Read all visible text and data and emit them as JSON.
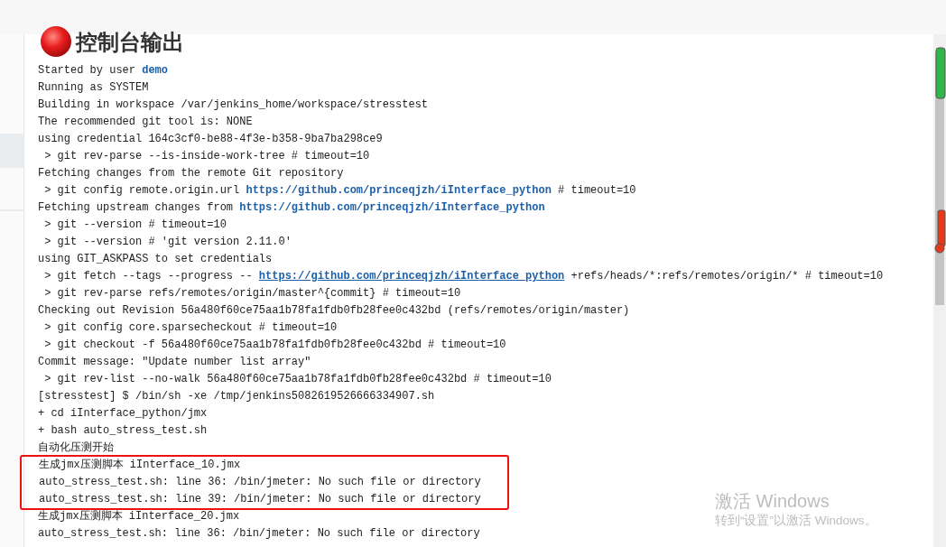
{
  "page_heading": "控制台输出",
  "console": [
    {
      "kind": "plain",
      "lines": [
        [
          {
            "kind": "text",
            "text": "Started by user "
          },
          {
            "kind": "link",
            "text": "demo",
            "underline": false
          }
        ],
        [
          {
            "kind": "text",
            "text": "Running as SYSTEM"
          }
        ],
        [
          {
            "kind": "text",
            "text": "Building in workspace /var/jenkins_home/workspace/stresstest"
          }
        ],
        [
          {
            "kind": "text",
            "text": "The recommended git tool is: NONE"
          }
        ],
        [
          {
            "kind": "text",
            "text": "using credential 164c3cf0-be88-4f3e-b358-9ba7ba298ce9"
          }
        ],
        [
          {
            "kind": "text",
            "text": " > git rev-parse --is-inside-work-tree # timeout=10"
          }
        ],
        [
          {
            "kind": "text",
            "text": "Fetching changes from the remote Git repository"
          }
        ],
        [
          {
            "kind": "text",
            "text": " > git config remote.origin.url "
          },
          {
            "kind": "link",
            "text": "https://github.com/princeqjzh/iInterface_python",
            "underline": false
          },
          {
            "kind": "text",
            "text": " # timeout=10"
          }
        ],
        [
          {
            "kind": "text",
            "text": "Fetching upstream changes from "
          },
          {
            "kind": "link",
            "text": "https://github.com/princeqjzh/iInterface_python",
            "underline": false
          }
        ],
        [
          {
            "kind": "text",
            "text": " > git --version # timeout=10"
          }
        ],
        [
          {
            "kind": "text",
            "text": " > git --version # 'git version 2.11.0'"
          }
        ],
        [
          {
            "kind": "text",
            "text": "using GIT_ASKPASS to set credentials"
          }
        ],
        [
          {
            "kind": "text",
            "text": " > git fetch --tags --progress -- "
          },
          {
            "kind": "link",
            "text": "https://github.com/princeqjzh/iInterface_python",
            "underline": true
          },
          {
            "kind": "text",
            "text": " +refs/heads/*:refs/remotes/origin/* # timeout=10"
          }
        ],
        [
          {
            "kind": "text",
            "text": " > git rev-parse refs/remotes/origin/master^{commit} # timeout=10"
          }
        ],
        [
          {
            "kind": "text",
            "text": "Checking out Revision 56a480f60ce75aa1b78fa1fdb0fb28fee0c432bd (refs/remotes/origin/master)"
          }
        ],
        [
          {
            "kind": "text",
            "text": " > git config core.sparsecheckout # timeout=10"
          }
        ],
        [
          {
            "kind": "text",
            "text": " > git checkout -f 56a480f60ce75aa1b78fa1fdb0fb28fee0c432bd # timeout=10"
          }
        ],
        [
          {
            "kind": "text",
            "text": "Commit message: \"Update number list array\""
          }
        ],
        [
          {
            "kind": "text",
            "text": " > git rev-list --no-walk 56a480f60ce75aa1b78fa1fdb0fb28fee0c432bd # timeout=10"
          }
        ],
        [
          {
            "kind": "text",
            "text": "[stresstest] $ /bin/sh -xe /tmp/jenkins5082619526666334907.sh"
          }
        ],
        [
          {
            "kind": "text",
            "text": "+ cd iInterface_python/jmx"
          }
        ],
        [
          {
            "kind": "text",
            "text": "+ bash auto_stress_test.sh"
          }
        ],
        [
          {
            "kind": "text",
            "text": "自动化压测开始"
          }
        ]
      ]
    },
    {
      "kind": "boxed",
      "lines": [
        [
          {
            "kind": "text",
            "text": "生成jmx压测脚本 iInterface_10.jmx"
          }
        ],
        [
          {
            "kind": "text",
            "text": "auto_stress_test.sh: line 36: /bin/jmeter: No such file or directory"
          }
        ],
        [
          {
            "kind": "text",
            "text": "auto_stress_test.sh: line 39: /bin/jmeter: No such file or directory"
          }
        ]
      ]
    },
    {
      "kind": "plain",
      "lines": [
        [
          {
            "kind": "text",
            "text": "生成jmx压测脚本 iInterface_20.jmx"
          }
        ],
        [
          {
            "kind": "text",
            "text": "auto_stress_test.sh: line 36: /bin/jmeter: No such file or directory"
          }
        ]
      ]
    }
  ],
  "os_watermark": {
    "title": "激活 Windows",
    "subtitle": "转到“设置”以激活 Windows。"
  }
}
